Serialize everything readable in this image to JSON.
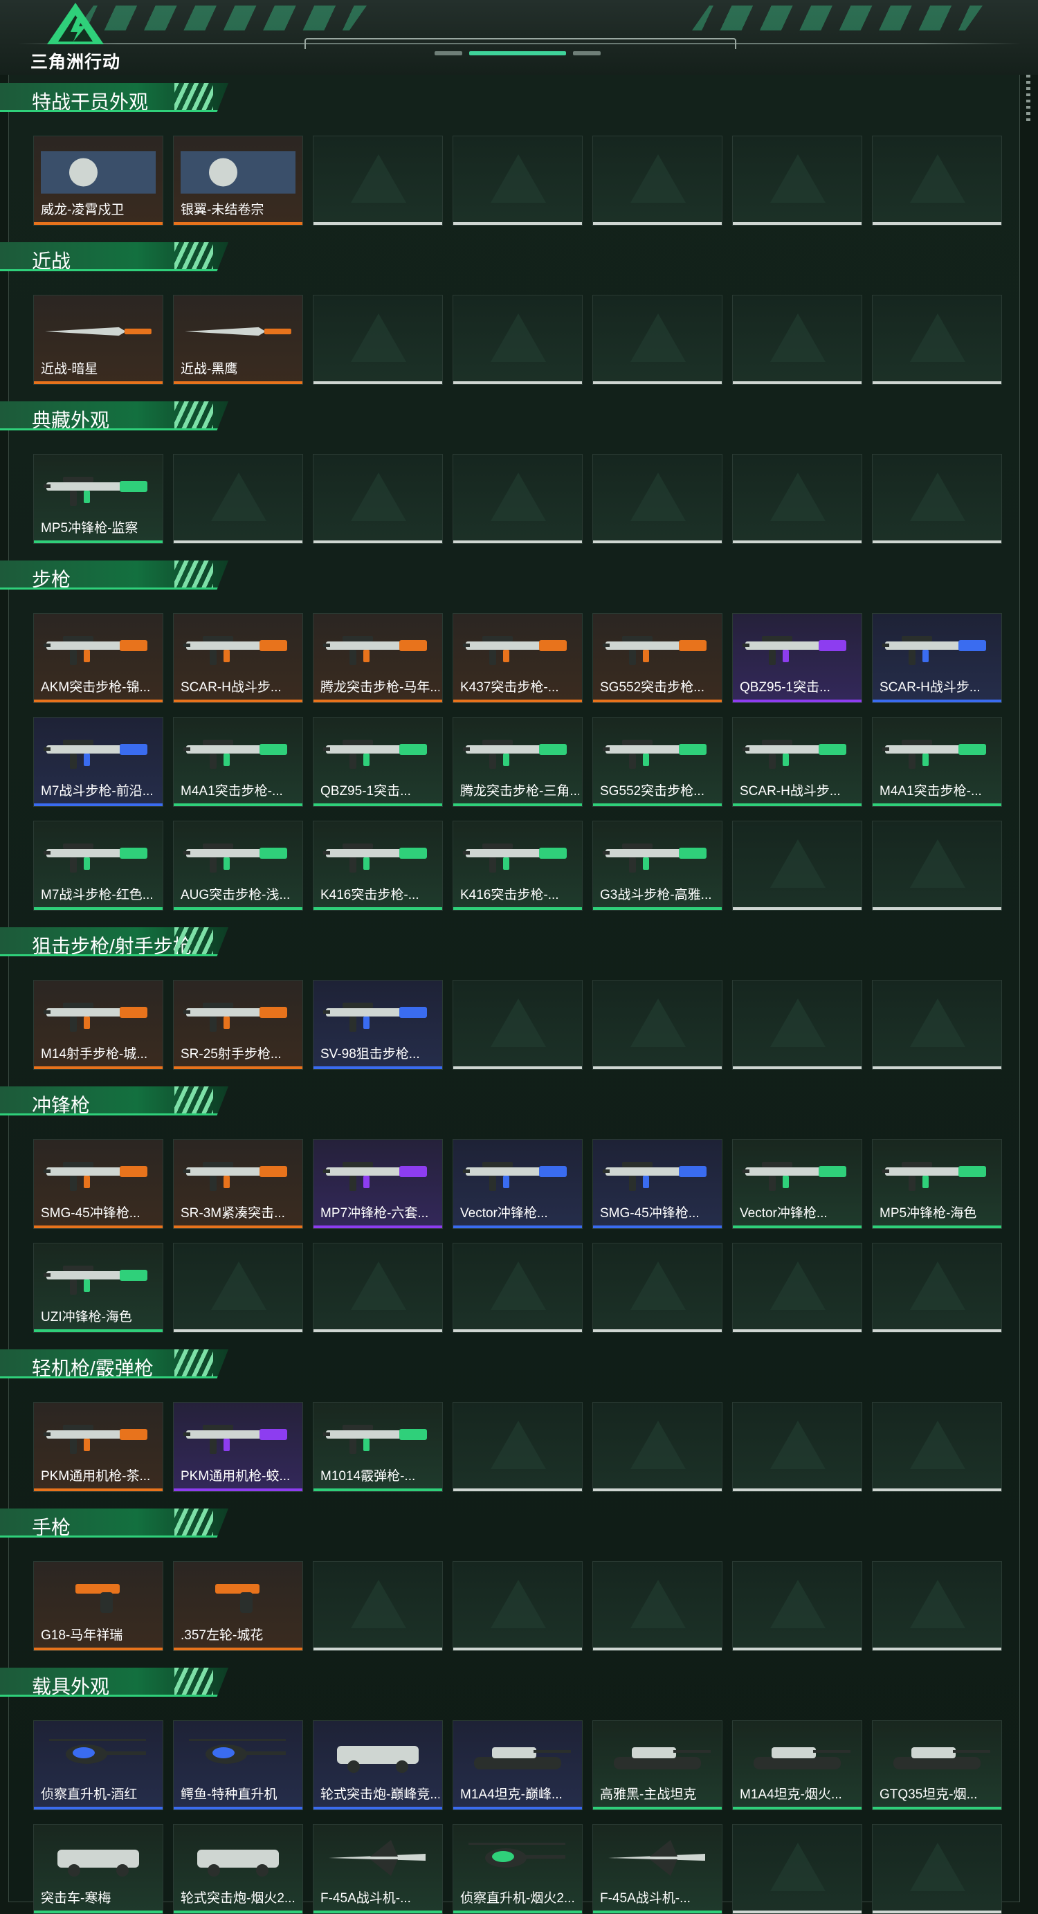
{
  "app": {
    "logo_text": "三角洲行动"
  },
  "sections": [
    {
      "title": "特战干员外观",
      "items": [
        {
          "label": "威龙-凌霄戍卫",
          "rarity": "orange",
          "icon": "operator-portrait",
          "photo": true
        },
        {
          "label": "银翼-未结卷宗",
          "rarity": "orange",
          "icon": "operator-portrait",
          "photo": true
        }
      ]
    },
    {
      "title": "近战",
      "items": [
        {
          "label": "近战-暗星",
          "rarity": "orange",
          "icon": "knife-icon",
          "photo": true
        },
        {
          "label": "近战-黑鹰",
          "rarity": "orange",
          "icon": "knife-icon",
          "photo": true
        }
      ]
    },
    {
      "title": "典藏外观",
      "items": [
        {
          "label": "MP5冲锋枪-监察",
          "rarity": "green",
          "icon": "smg-icon"
        }
      ]
    },
    {
      "title": "步枪",
      "items": [
        {
          "label": "AKM突击步枪-锦...",
          "rarity": "orange",
          "icon": "rifle-icon"
        },
        {
          "label": "SCAR-H战斗步...",
          "rarity": "orange",
          "icon": "rifle-icon"
        },
        {
          "label": "腾龙突击步枪-马年...",
          "rarity": "orange",
          "icon": "rifle-icon"
        },
        {
          "label": "K437突击步枪-...",
          "rarity": "orange",
          "icon": "rifle-icon"
        },
        {
          "label": "SG552突击步枪...",
          "rarity": "orange",
          "icon": "rifle-icon"
        },
        {
          "label": "QBZ95-1突击...",
          "rarity": "purple",
          "icon": "rifle-icon"
        },
        {
          "label": "SCAR-H战斗步...",
          "rarity": "blue",
          "icon": "rifle-icon"
        },
        {
          "label": "M7战斗步枪-前沿...",
          "rarity": "blue",
          "icon": "rifle-icon"
        },
        {
          "label": "M4A1突击步枪-...",
          "rarity": "green",
          "icon": "rifle-icon"
        },
        {
          "label": "QBZ95-1突击...",
          "rarity": "green",
          "icon": "rifle-icon"
        },
        {
          "label": "腾龙突击步枪-三角...",
          "rarity": "green",
          "icon": "rifle-icon"
        },
        {
          "label": "SG552突击步枪...",
          "rarity": "green",
          "icon": "rifle-icon"
        },
        {
          "label": "SCAR-H战斗步...",
          "rarity": "green",
          "icon": "rifle-icon"
        },
        {
          "label": "M4A1突击步枪-...",
          "rarity": "green",
          "icon": "rifle-icon"
        },
        {
          "label": "M7战斗步枪-红色...",
          "rarity": "green",
          "icon": "rifle-icon"
        },
        {
          "label": "AUG突击步枪-浅...",
          "rarity": "green",
          "icon": "rifle-icon"
        },
        {
          "label": "K416突击步枪-...",
          "rarity": "green",
          "icon": "rifle-icon"
        },
        {
          "label": "K416突击步枪-...",
          "rarity": "green",
          "icon": "rifle-icon"
        },
        {
          "label": "G3战斗步枪-高雅...",
          "rarity": "green",
          "icon": "rifle-icon"
        }
      ]
    },
    {
      "title": "狙击步枪/射手步枪",
      "items": [
        {
          "label": "M14射手步枪-城...",
          "rarity": "orange",
          "icon": "sniper-icon"
        },
        {
          "label": "SR-25射手步枪...",
          "rarity": "orange",
          "icon": "sniper-icon"
        },
        {
          "label": "SV-98狙击步枪...",
          "rarity": "blue",
          "icon": "sniper-icon"
        }
      ]
    },
    {
      "title": "冲锋枪",
      "items": [
        {
          "label": "SMG-45冲锋枪...",
          "rarity": "orange",
          "icon": "smg-icon"
        },
        {
          "label": "SR-3M紧凑突击...",
          "rarity": "orange",
          "icon": "smg-icon"
        },
        {
          "label": "MP7冲锋枪-六套...",
          "rarity": "purple",
          "icon": "smg-icon"
        },
        {
          "label": "Vector冲锋枪...",
          "rarity": "blue",
          "icon": "smg-icon"
        },
        {
          "label": "SMG-45冲锋枪...",
          "rarity": "blue",
          "icon": "smg-icon"
        },
        {
          "label": "Vector冲锋枪...",
          "rarity": "green",
          "icon": "smg-icon"
        },
        {
          "label": "MP5冲锋枪-海色",
          "rarity": "green",
          "icon": "smg-icon"
        },
        {
          "label": "UZI冲锋枪-海色",
          "rarity": "green",
          "icon": "smg-icon"
        }
      ]
    },
    {
      "title": "轻机枪/霰弹枪",
      "items": [
        {
          "label": "PKM通用机枪-茶...",
          "rarity": "orange",
          "icon": "lmg-icon"
        },
        {
          "label": "PKM通用机枪-蛟...",
          "rarity": "purple",
          "icon": "lmg-icon"
        },
        {
          "label": "M1014霰弹枪-...",
          "rarity": "green",
          "icon": "shotgun-icon"
        }
      ]
    },
    {
      "title": "手枪",
      "items": [
        {
          "label": "G18-马年祥瑞",
          "rarity": "orange",
          "icon": "pistol-icon"
        },
        {
          "label": ".357左轮-城花",
          "rarity": "orange",
          "icon": "revolver-icon"
        }
      ]
    },
    {
      "title": "载具外观",
      "items": [
        {
          "label": "侦察直升机-酒红",
          "rarity": "blue",
          "icon": "helicopter-icon"
        },
        {
          "label": "鳄鱼-特种直升机",
          "rarity": "blue",
          "icon": "helicopter-icon"
        },
        {
          "label": "轮式突击炮-巅峰竞...",
          "rarity": "blue",
          "icon": "vehicle-icon"
        },
        {
          "label": "M1A4坦克-巅峰...",
          "rarity": "blue",
          "icon": "tank-icon"
        },
        {
          "label": "高雅黑-主战坦克",
          "rarity": "green",
          "icon": "tank-icon"
        },
        {
          "label": "M1A4坦克-烟火...",
          "rarity": "green",
          "icon": "tank-icon"
        },
        {
          "label": "GTQ35坦克-烟...",
          "rarity": "green",
          "icon": "tank-icon"
        },
        {
          "label": "突击车-寒梅",
          "rarity": "green",
          "icon": "vehicle-icon"
        },
        {
          "label": "轮式突击炮-烟火2...",
          "rarity": "green",
          "icon": "vehicle-icon"
        },
        {
          "label": "F-45A战斗机-...",
          "rarity": "green",
          "icon": "jet-icon"
        },
        {
          "label": "侦察直升机-烟火2...",
          "rarity": "green",
          "icon": "helicopter-icon"
        },
        {
          "label": "F-45A战斗机-...",
          "rarity": "green",
          "icon": "jet-icon"
        }
      ]
    }
  ],
  "colors": {
    "orange": "#e8731c",
    "blue": "#3a6cf0",
    "purple": "#8d3df0",
    "green": "#2fd07a",
    "empty": "#cfd6d2",
    "accent": "#3fd39a"
  }
}
